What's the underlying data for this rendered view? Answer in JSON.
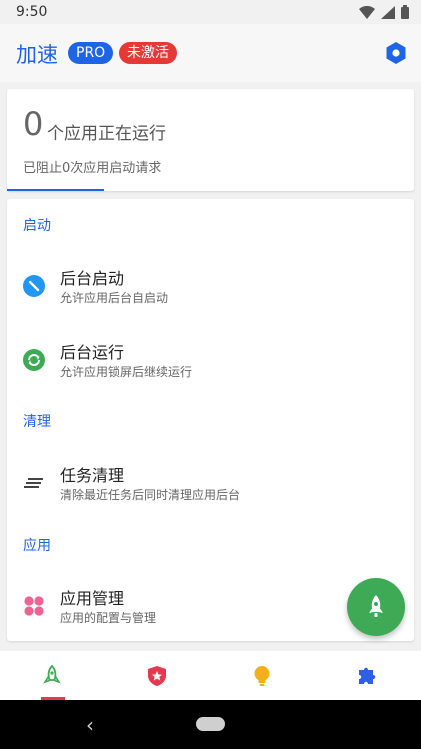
{
  "status_bar": {
    "time": "9:50"
  },
  "app_bar": {
    "title": "加速",
    "badges": {
      "pro": "PRO",
      "inactive": "未激活"
    },
    "settings_icon": "hexagon-settings-icon"
  },
  "stats": {
    "running_count": "0",
    "running_suffix": "个应用正在运行",
    "blocked_text": "已阻止0次应用启动请求"
  },
  "sections": {
    "startup": "启动",
    "clean": "清理",
    "apps": "应用"
  },
  "items": [
    {
      "label": "后台启动",
      "desc": "允许应用后台自启动",
      "icon": "blocked-circle-icon"
    },
    {
      "label": "后台运行",
      "desc": "允许应用锁屏后继续运行",
      "icon": "sync-icon"
    },
    {
      "label": "任务清理",
      "desc": "清除最近任务后同时清理应用后台",
      "icon": "lines-icon"
    },
    {
      "label": "应用管理",
      "desc": "应用的配置与管理",
      "icon": "grid-dots-icon"
    }
  ],
  "colors": {
    "accent": "#1e64e6",
    "danger": "#e53935",
    "success": "#3faa55",
    "tab_shield": "#e53950",
    "tab_bulb": "#f2b01e",
    "tab_puzzle": "#2f5ee8"
  },
  "bottom_nav": {
    "tabs": [
      {
        "icon": "rocket-outline-icon",
        "selected": true
      },
      {
        "icon": "shield-star-icon",
        "selected": false
      },
      {
        "icon": "bulb-icon",
        "selected": false
      },
      {
        "icon": "puzzle-icon",
        "selected": false
      }
    ]
  }
}
